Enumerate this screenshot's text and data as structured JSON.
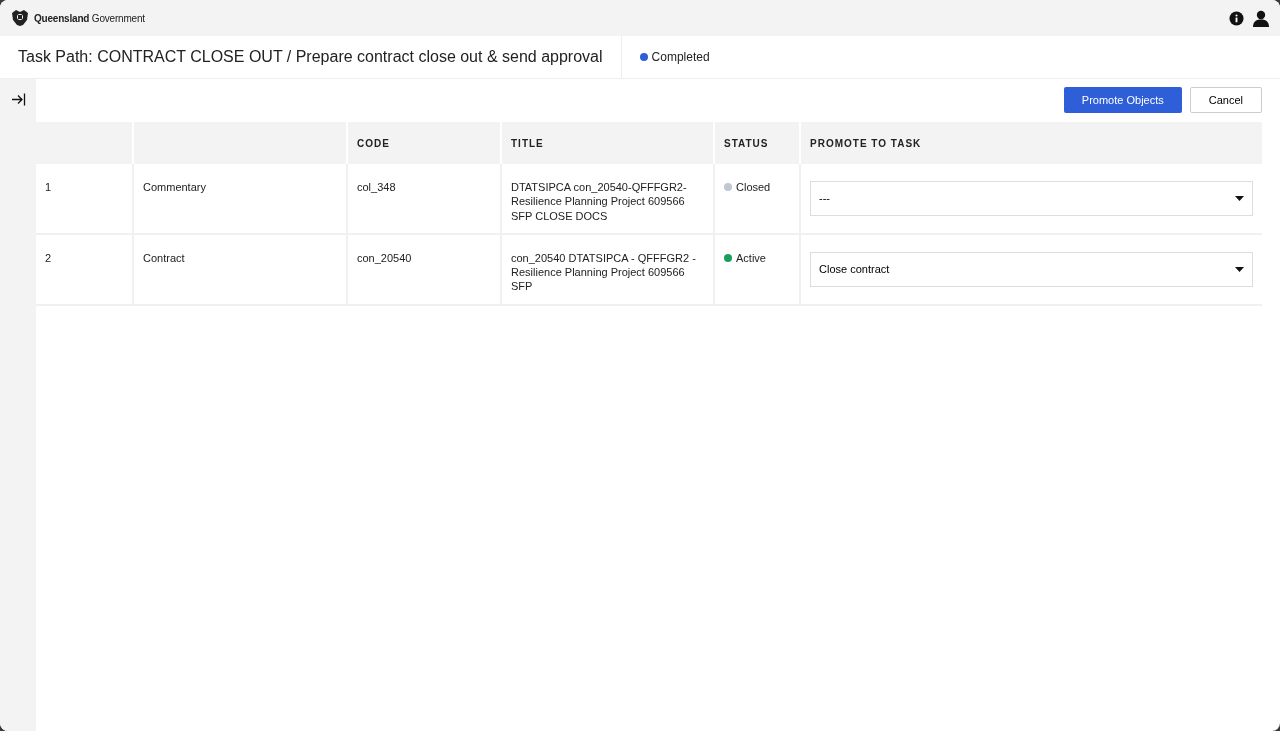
{
  "header": {
    "logo_text": "**Queensland** Government"
  },
  "page": {
    "title": "Task Path: CONTRACT CLOSE OUT / Prepare contract close out & send approval",
    "status": {
      "label": "Completed",
      "color": "#2e5fd9"
    }
  },
  "actions": [
    {
      "label": "Promote Objects",
      "kind": "primary"
    },
    {
      "label": "Cancel",
      "kind": "secondary"
    }
  ],
  "table": {
    "columns": [
      "",
      "",
      "CODE",
      "TITLE",
      "STATUS",
      "PROMOTE TO TASK"
    ],
    "rows": [
      {
        "number": "1",
        "type": "Commentary",
        "code": "col_348",
        "title": "DTATSIPCA con_20540-QFFFGR2- Resilience Planning Project 609566 SFP CLOSE DOCS",
        "status": "Closed",
        "color": "#c0c6d4",
        "promote_to": "---"
      },
      {
        "number": "2",
        "type": "Contract",
        "code": "con_20540",
        "title": "con_20540 DTATSIPCA - QFFFGR2 - Resilience Planning Project 609566 SFP",
        "status": "Active",
        "color": "#1a9e5c",
        "promote_to": "Close contract"
      }
    ]
  }
}
